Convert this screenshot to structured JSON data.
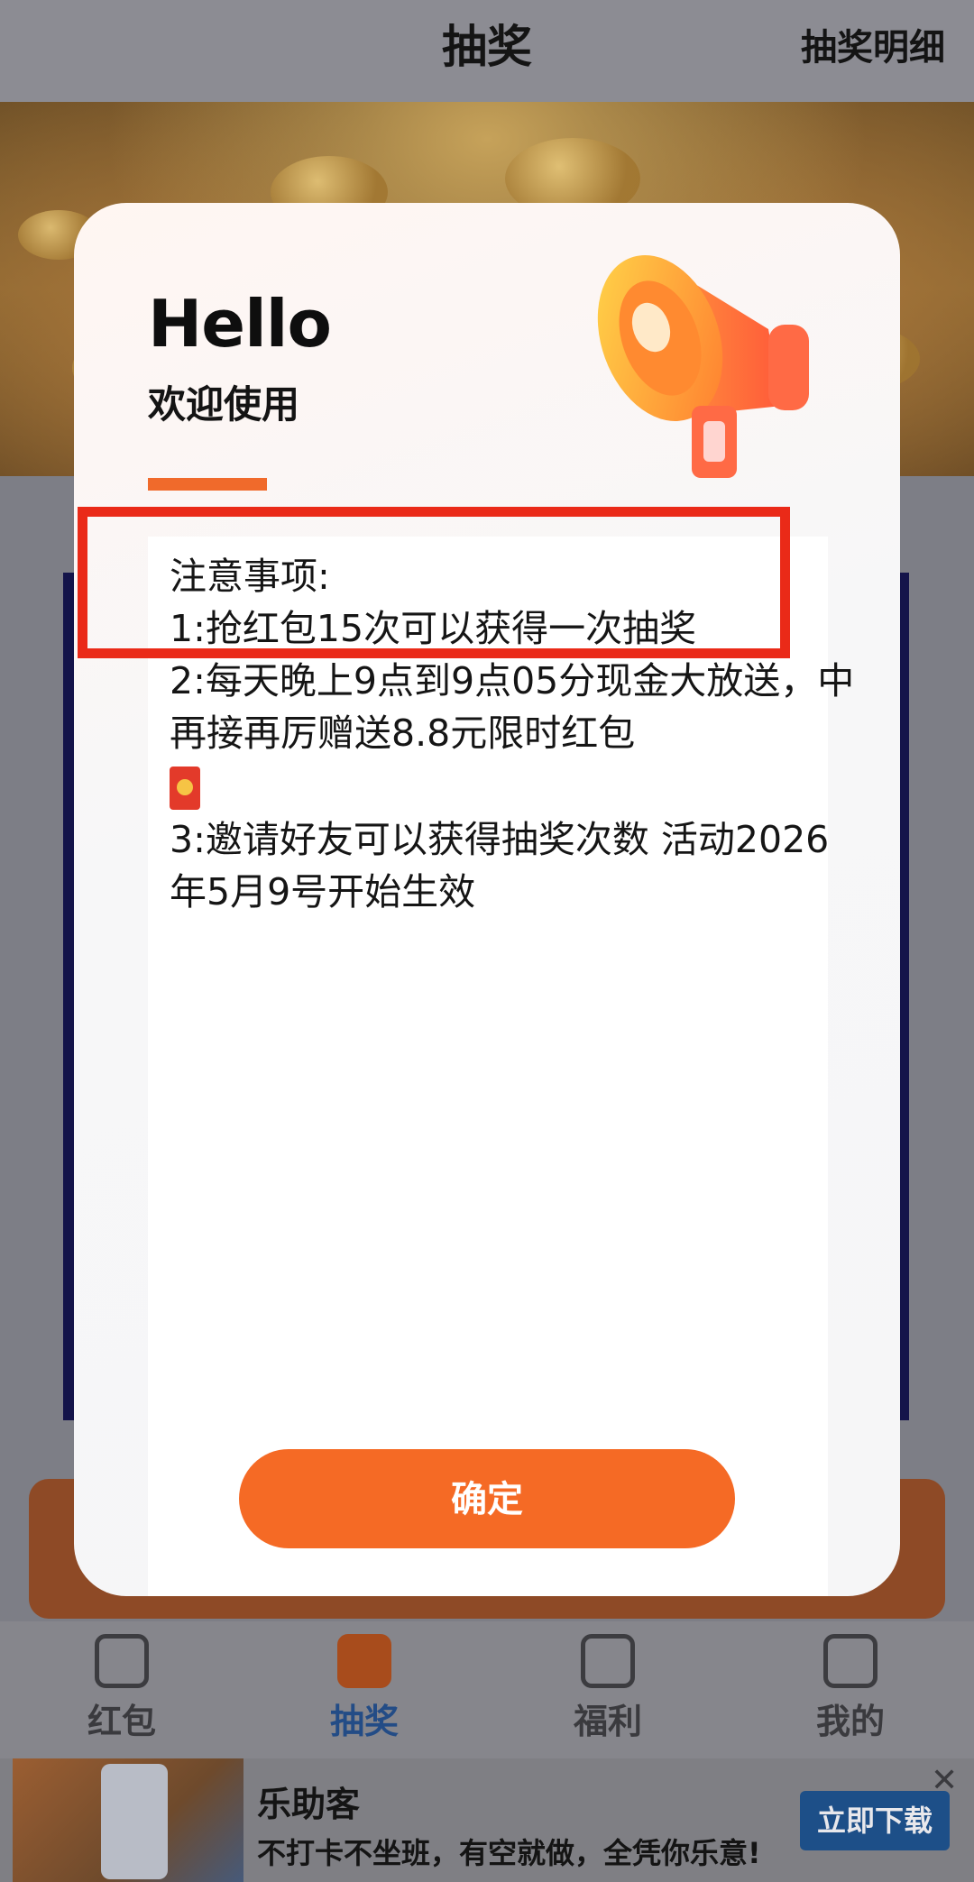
{
  "header": {
    "title": "抽奖",
    "detail_link": "抽奖明细"
  },
  "modal": {
    "greeting": "Hello",
    "welcome": "欢迎使用",
    "notes_heading": "注意事项:",
    "notes": [
      "1:抢红包15次可以获得一次抽奖",
      "2:每天晚上9点到9点05分现金大放送，中再接再厉赠送8.8元限时红包",
      "3:邀请好友可以获得抽奖次数 活动2026年5月9号开始生效"
    ],
    "confirm_label": "确定"
  },
  "tabs": [
    {
      "label": "红包",
      "icon": "camera-icon",
      "active": false
    },
    {
      "label": "抽奖",
      "icon": "play-icon",
      "active": true
    },
    {
      "label": "福利",
      "icon": "tv-icon",
      "active": false
    },
    {
      "label": "我的",
      "icon": "profile-icon",
      "active": false
    }
  ],
  "ad": {
    "app_name": "乐助客",
    "slogan": "不打卡不坐班，有空就做，全凭你乐意!",
    "download_label": "立即下载",
    "close_symbol": "✕"
  },
  "colors": {
    "accent_orange": "#f56a25",
    "highlight_red": "#ea2a18",
    "active_tab_text": "#234c86"
  }
}
